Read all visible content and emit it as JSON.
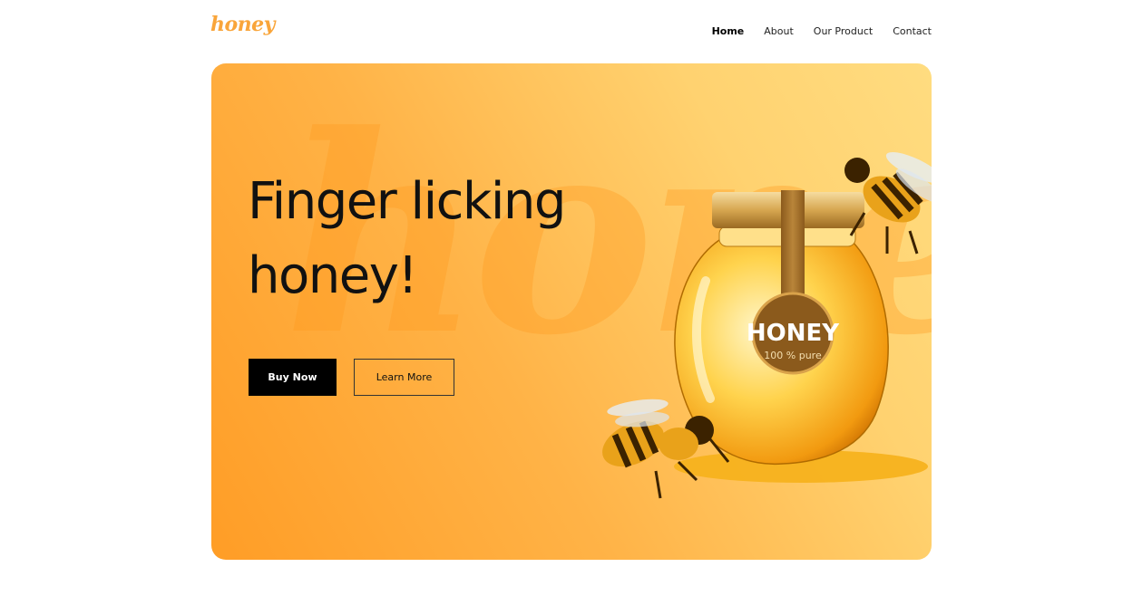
{
  "brand": {
    "logo_text": "honey"
  },
  "nav": {
    "items": [
      {
        "label": "Home",
        "active": true
      },
      {
        "label": "About",
        "active": false
      },
      {
        "label": "Our Product",
        "active": false
      },
      {
        "label": "Contact",
        "active": false
      }
    ]
  },
  "hero": {
    "watermark": "honey",
    "title": "Finger licking honey!",
    "primary_button": "Buy Now",
    "secondary_button": "Learn More",
    "jar_label": {
      "title": "HONEY",
      "subtitle": "100 % pure"
    }
  },
  "colors": {
    "accent": "#f9a53a",
    "hero_start": "#ff9d26",
    "hero_end": "#ffdc80",
    "button_dark": "#000000"
  }
}
